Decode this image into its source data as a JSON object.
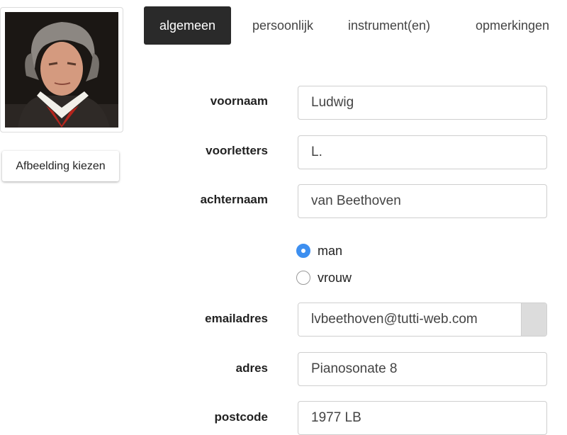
{
  "profile": {
    "photo_alt": "Portret",
    "choose_image_label": "Afbeelding kiezen"
  },
  "tabs": [
    {
      "label": "algemeen",
      "active": true
    },
    {
      "label": "persoonlijk",
      "active": false
    },
    {
      "label": "instrument(en)",
      "active": false
    },
    {
      "label": "opmerkingen",
      "active": false
    }
  ],
  "form": {
    "voornaam": {
      "label": "voornaam",
      "value": "Ludwig"
    },
    "voorletters": {
      "label": "voorletters",
      "value": "L."
    },
    "achternaam": {
      "label": "achternaam",
      "value": "van Beethoven"
    },
    "gender": {
      "options": [
        {
          "label": "man",
          "checked": true
        },
        {
          "label": "vrouw",
          "checked": false
        }
      ]
    },
    "emailadres": {
      "label": "emailadres",
      "value": "lvbeethoven@tutti-web.com"
    },
    "adres": {
      "label": "adres",
      "value": "Pianosonate 8"
    },
    "postcode": {
      "label": "postcode",
      "value": "1977 LB"
    }
  },
  "colors": {
    "active_tab_bg": "#2a2a2a",
    "radio_checked": "#3d8ff0",
    "field_border": "#cfcfcf"
  }
}
